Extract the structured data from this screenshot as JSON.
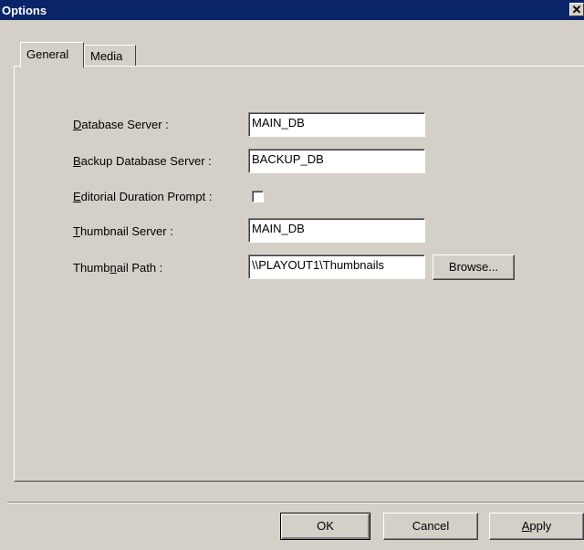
{
  "window": {
    "title": "Options",
    "close_glyph": "✕"
  },
  "tabs": [
    {
      "label": "General",
      "active": true
    },
    {
      "label": "Media",
      "active": false
    }
  ],
  "fields": {
    "database_server": {
      "label_pre": "",
      "label_key": "D",
      "label_post": "atabase Server :",
      "value": "MAIN_DB"
    },
    "backup_server": {
      "label_pre": "",
      "label_key": "B",
      "label_post": "ackup Database Server :",
      "value": "BACKUP_DB"
    },
    "editorial_prompt": {
      "label_pre": "",
      "label_key": "E",
      "label_post": "ditorial Duration Prompt :",
      "checked": false
    },
    "thumbnail_server": {
      "label_pre": "",
      "label_key": "T",
      "label_post": "humbnail Server :",
      "value": "MAIN_DB"
    },
    "thumbnail_path": {
      "label_pre": "Thumb",
      "label_key": "n",
      "label_post": "ail Path :",
      "value": "\\\\PLAYOUT1\\Thumbnails",
      "browse_label": "Browse..."
    }
  },
  "buttons": {
    "ok": "OK",
    "cancel": "Cancel",
    "apply_key": "A",
    "apply_rest": "pply"
  }
}
